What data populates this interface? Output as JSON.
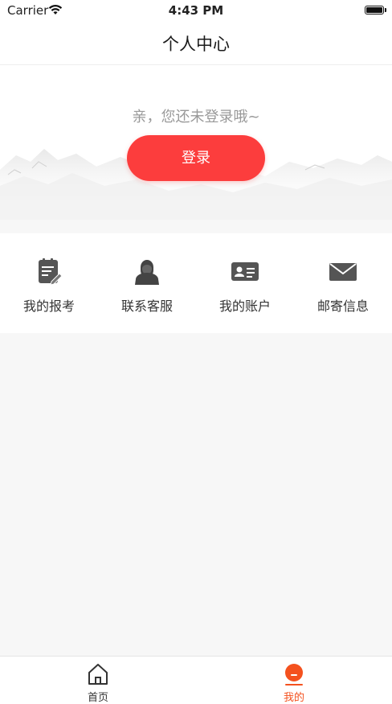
{
  "status_bar": {
    "carrier": "Carrier",
    "time": "4:43 PM"
  },
  "nav": {
    "title": "个人中心"
  },
  "hero": {
    "hint": "亲，您还未登录哦~",
    "login_label": "登录"
  },
  "menu": [
    {
      "label": "我的报考",
      "icon": "exam-icon"
    },
    {
      "label": "联系客服",
      "icon": "customer-service-icon"
    },
    {
      "label": "我的账户",
      "icon": "id-card-icon"
    },
    {
      "label": "邮寄信息",
      "icon": "envelope-icon"
    }
  ],
  "tabs": [
    {
      "label": "首页",
      "icon": "home-icon",
      "active": false
    },
    {
      "label": "我的",
      "icon": "profile-icon",
      "active": true
    }
  ],
  "colors": {
    "accent": "#fc3d3d",
    "tab_active": "#f4511e",
    "tab_inactive": "#333333",
    "icon_gray": "#555555"
  }
}
